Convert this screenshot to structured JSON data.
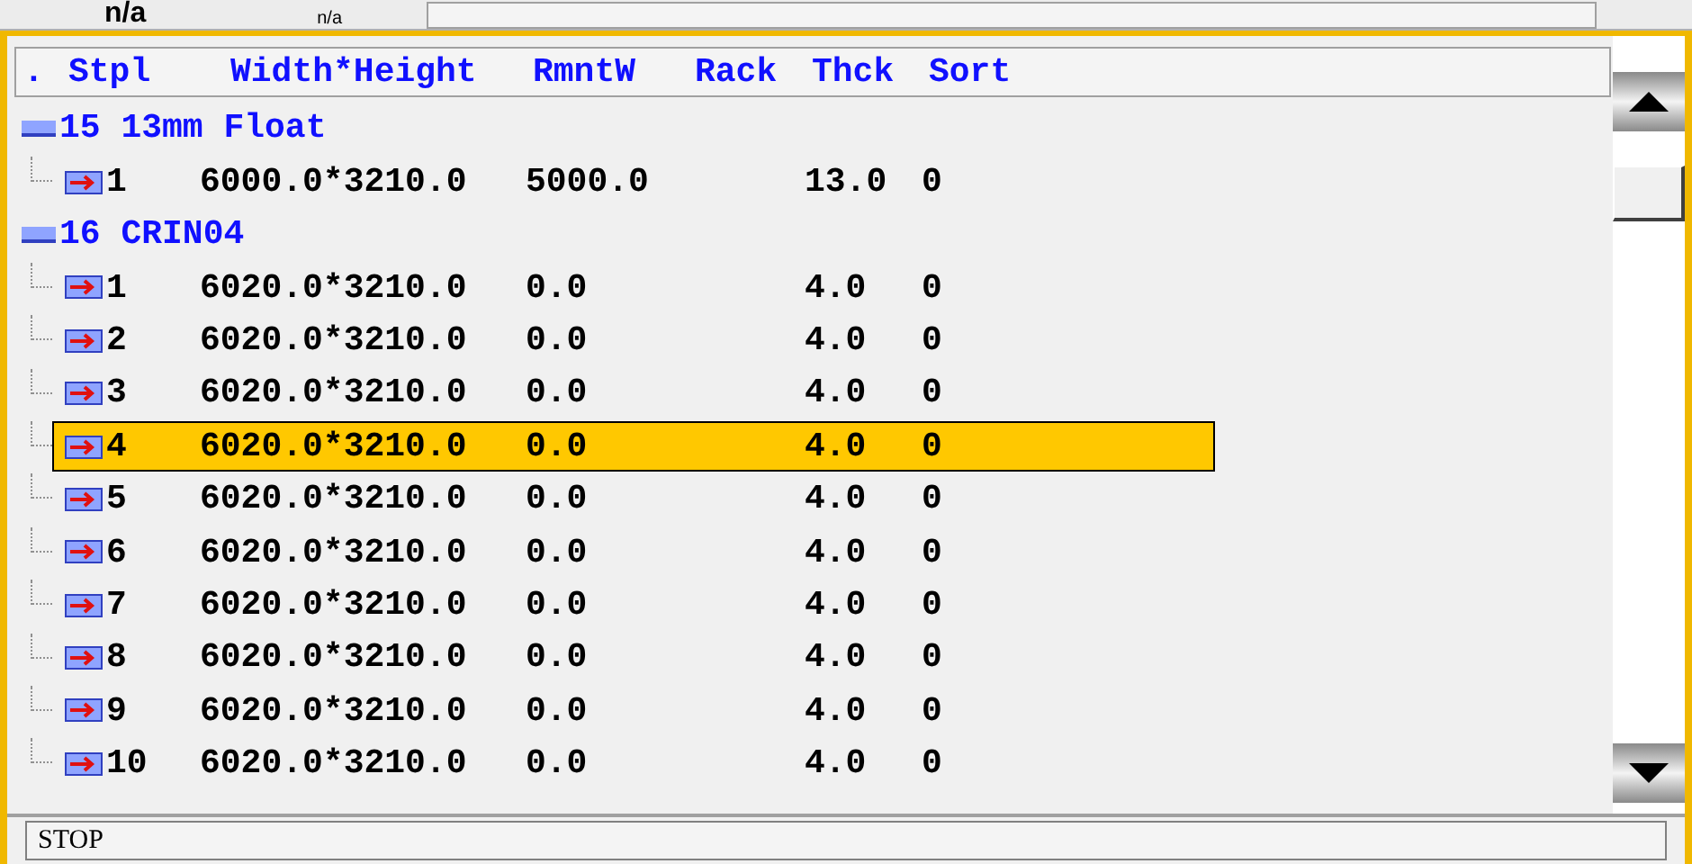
{
  "top_strip": {
    "labels": [
      "n/a",
      "n/a"
    ]
  },
  "table": {
    "columns": [
      ".",
      "Stpl",
      "Width*Height",
      "RmntW",
      "Rack",
      "Thck",
      "Sort"
    ],
    "groups": [
      {
        "label": "15 13mm Float",
        "children": [
          {
            "stpl": "1",
            "size": "6000.0*3210.0",
            "rmntw": "5000.0",
            "thck": "13.0",
            "sort": "0",
            "selected": false
          }
        ]
      },
      {
        "label": "16 CRIN04",
        "children": [
          {
            "stpl": "1",
            "size": "6020.0*3210.0",
            "rmntw": "0.0",
            "thck": "4.0",
            "sort": "0",
            "selected": false
          },
          {
            "stpl": "2",
            "size": "6020.0*3210.0",
            "rmntw": "0.0",
            "thck": "4.0",
            "sort": "0",
            "selected": false
          },
          {
            "stpl": "3",
            "size": "6020.0*3210.0",
            "rmntw": "0.0",
            "thck": "4.0",
            "sort": "0",
            "selected": false
          },
          {
            "stpl": "4",
            "size": "6020.0*3210.0",
            "rmntw": "0.0",
            "thck": "4.0",
            "sort": "0",
            "selected": true
          },
          {
            "stpl": "5",
            "size": "6020.0*3210.0",
            "rmntw": "0.0",
            "thck": "4.0",
            "sort": "0",
            "selected": false
          },
          {
            "stpl": "6",
            "size": "6020.0*3210.0",
            "rmntw": "0.0",
            "thck": "4.0",
            "sort": "0",
            "selected": false
          },
          {
            "stpl": "7",
            "size": "6020.0*3210.0",
            "rmntw": "0.0",
            "thck": "4.0",
            "sort": "0",
            "selected": false
          },
          {
            "stpl": "8",
            "size": "6020.0*3210.0",
            "rmntw": "0.0",
            "thck": "4.0",
            "sort": "0",
            "selected": false
          },
          {
            "stpl": "9",
            "size": "6020.0*3210.0",
            "rmntw": "0.0",
            "thck": "4.0",
            "sort": "0",
            "selected": false
          },
          {
            "stpl": "10",
            "size": "6020.0*3210.0",
            "rmntw": "0.0",
            "thck": "4.0",
            "sort": "0",
            "selected": false
          }
        ]
      }
    ]
  },
  "status_bar": {
    "text": "STOP"
  }
}
